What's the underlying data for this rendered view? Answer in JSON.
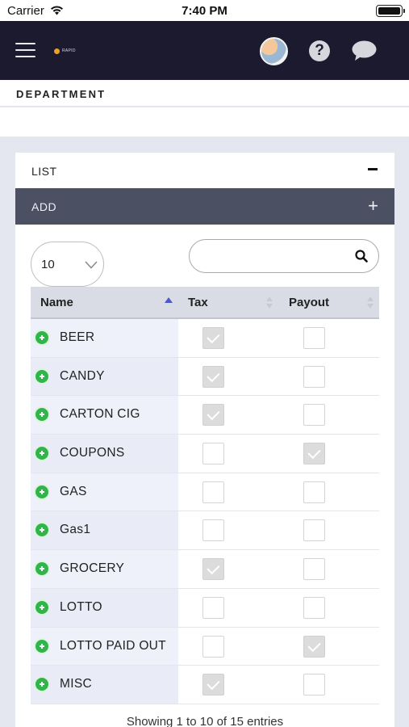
{
  "status_bar": {
    "carrier": "Carrier",
    "time": "7:40 PM",
    "wifi_icon": "wifi-icon",
    "battery_icon": "battery-icon"
  },
  "header": {
    "logo_text": "RAPID",
    "menu_icon": "hamburger-icon",
    "help_icon": "help-icon",
    "chat_icon": "chat-bubble-icon",
    "bg_color": "#1b1a2e"
  },
  "page": {
    "title": "DEPARTMENT"
  },
  "panel": {
    "list_label": "LIST",
    "add_label": "ADD",
    "add_bar_color": "#4b5062"
  },
  "controls": {
    "page_length": "10",
    "search_value": "",
    "search_placeholder": ""
  },
  "table": {
    "columns": [
      "Name",
      "Tax",
      "Payout"
    ],
    "rows": [
      {
        "name": "BEER",
        "tax": true,
        "payout": false
      },
      {
        "name": "CANDY",
        "tax": true,
        "payout": false
      },
      {
        "name": "CARTON CIG",
        "tax": true,
        "payout": false
      },
      {
        "name": "COUPONS",
        "tax": false,
        "payout": true
      },
      {
        "name": "GAS",
        "tax": false,
        "payout": false
      },
      {
        "name": "Gas1",
        "tax": false,
        "payout": false
      },
      {
        "name": "GROCERY",
        "tax": true,
        "payout": false
      },
      {
        "name": "LOTTO",
        "tax": false,
        "payout": false
      },
      {
        "name": "LOTTO PAID OUT",
        "tax": false,
        "payout": true
      },
      {
        "name": "MISC",
        "tax": true,
        "payout": false
      }
    ],
    "info": "Showing 1 to 10 of 15 entries"
  }
}
